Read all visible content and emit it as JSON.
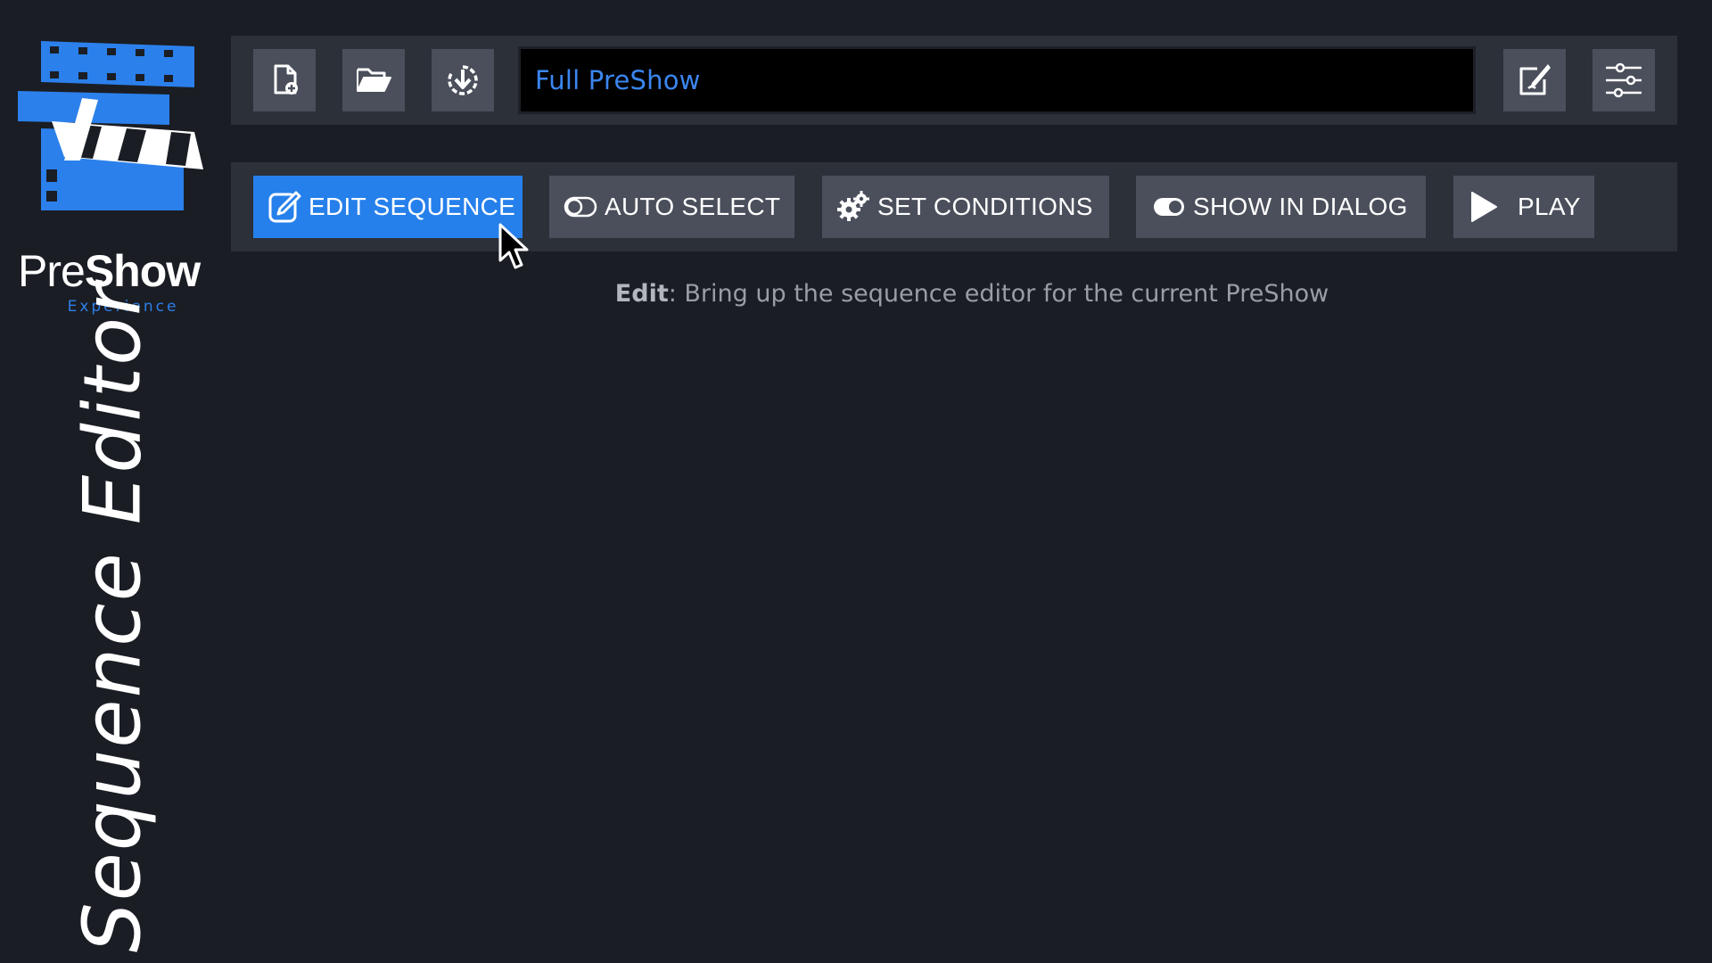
{
  "logo": {
    "word_regular": "Pre",
    "word_bold": "Show",
    "subtitle": "Experience"
  },
  "page_title": "Sequence Editor",
  "toolbar": {
    "new_icon": "new-file-icon",
    "open_icon": "folder-open-icon",
    "save_icon": "save-download-icon",
    "preshow_name": "Full PreShow",
    "edit_name_icon": "edit-note-icon",
    "settings_icon": "sliders-icon"
  },
  "actions": [
    {
      "label": "EDIT SEQUENCE",
      "icon": "pencil-icon",
      "active": true
    },
    {
      "label": "AUTO SELECT",
      "icon": "toggle-off-icon",
      "active": false
    },
    {
      "label": "SET CONDITIONS",
      "icon": "gears-icon",
      "active": false
    },
    {
      "label": "SHOW IN DIALOG",
      "icon": "toggle-on-icon",
      "active": false
    },
    {
      "label": "PLAY",
      "icon": "play-icon",
      "active": false
    }
  ],
  "description": {
    "term": "Edit",
    "text": ": Bring up the sequence editor for the current PreShow"
  },
  "colors": {
    "background": "#1a1d24",
    "panel": "#2c3039",
    "button": "#4a4f5b",
    "accent": "#2680eb",
    "title_text": "#3b86f0"
  }
}
